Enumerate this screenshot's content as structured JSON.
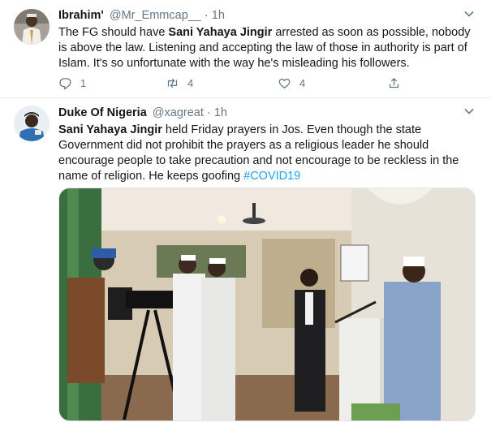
{
  "tweets": [
    {
      "name": "Ibrahim'",
      "handle": "@Mr_Emmcap__",
      "separator": "·",
      "time": "1h",
      "text": {
        "bold_1": "Sani Yahaya Jingir",
        "part_1": "The FG should have ",
        "part_2": " arrested as soon as possible, nobody is above the law. Listening and accepting the law of those in authority is part of Islam. It's so unfortunate with the way he's misleading his followers."
      },
      "reply_count": "1",
      "retweet_count": "4",
      "like_count": "4"
    },
    {
      "name": "Duke Of Nigeria",
      "handle": "@xagreat",
      "separator": "·",
      "time": "1h",
      "text": {
        "bold_1": "Sani Yahaya Jingir",
        "part_2": " held Friday prayers in Jos. Even though the state Government did not prohibit the prayers as a religious leader he should encourage people to take precaution and not encourage to be reckless in the name of religion. He keeps goofing ",
        "hashtag": "#COVID19"
      }
    }
  ],
  "icons": {
    "caret": "chevron-down-icon",
    "reply": "reply-icon",
    "retweet": "retweet-icon",
    "like": "heart-icon",
    "share": "share-icon"
  },
  "colors": {
    "accent": "#1da1f2",
    "muted": "#657786",
    "divider": "#e6ecf0"
  }
}
